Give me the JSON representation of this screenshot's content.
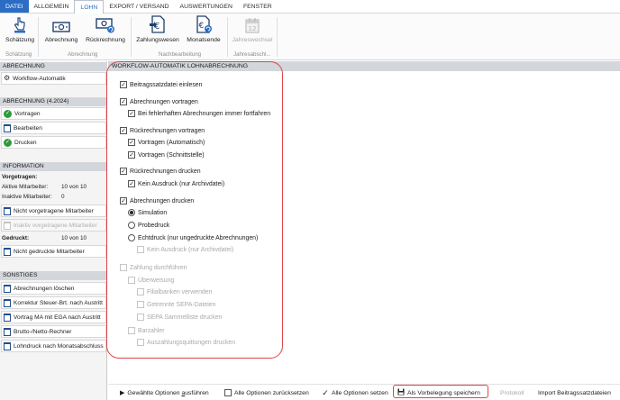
{
  "menu": {
    "tabs": [
      "DATEI",
      "ALLGEMEIN",
      "LOHN",
      "EXPORT / VERSAND",
      "AUSWERTUNGEN",
      "FENSTER"
    ],
    "active_tab": "LOHN"
  },
  "ribbon": {
    "buttons": [
      {
        "label": "Schätzung",
        "icon": "hand-pointer-icon",
        "enabled": true
      },
      {
        "label": "Abrechnung",
        "icon": "money-icon",
        "enabled": true
      },
      {
        "label": "Rückrechnung",
        "icon": "money-refresh-icon",
        "enabled": true
      },
      {
        "label": "Zahlungswesen",
        "icon": "euro-document-icon",
        "enabled": true
      },
      {
        "label": "Monatsende",
        "icon": "euro-document-refresh-icon",
        "enabled": true
      },
      {
        "label": "Jahreswechsel",
        "icon": "calendar-icon",
        "enabled": false
      }
    ],
    "calendar_day": "12",
    "groups": [
      "Schätzung",
      "Abrechnung",
      "Nachbearbeitung",
      "Jahresabschl..."
    ]
  },
  "left_panel": {
    "abrechnung_header": "ABRECHNUNG",
    "workflow_item": "Workflow-Automatik",
    "period_header": "ABRECHNUNG (4.2024)",
    "period_items": [
      "Vortragen",
      "Bearbeiten",
      "Drucken"
    ],
    "info_header": "INFORMATION",
    "vorgetragen_label": "Vorgetragen:",
    "aktive_label": "Aktive Mitarbeiter:",
    "aktive_value": "10 von 10",
    "inaktive_label": "Inaktive Mitarbeiter:",
    "inaktive_value": "0",
    "nicht_vorgetragen": "Nicht vorgetragene Mitarbeiter",
    "inaktiv_vorgetragen": "Inaktiv vorgetragene Mitarbeiter",
    "gedruckt_label": "Gedruckt:",
    "gedruckt_value": "10 von 10",
    "nicht_gedruckt": "Nicht gedruckte Mitarbeiter",
    "sonstiges_header": "SONSTIGES",
    "sonstiges_items": [
      "Abrechnungen löschen",
      "Korrektur Steuer-Brt. nach Austritt",
      "Vortrag MA mit EGA nach Austritt",
      "Brutto-/Netto-Rechner",
      "Lohndruck nach Monatsabschluss"
    ]
  },
  "main": {
    "header": "WORKFLOW-AUTOMATIK LOHNABRECHNUNG",
    "options": {
      "beitragssatzdatei": "Beitragssatzdatei einlesen",
      "abrechnungen_vortragen": "Abrechnungen vortragen",
      "bei_fehlerhaften": "Bei fehlerhaften Abrechnungen immer fortfahren",
      "rueckrechnungen_vortragen": "Rückrechnungen vortragen",
      "vortragen_automatisch": "Vortragen (Automatisch)",
      "vortragen_schnittstelle": "Vortragen (Schnittstelle)",
      "rueckrechnungen_drucken": "Rückrechnungen drucken",
      "kein_ausdruck_1": "Kein Ausdruck (nur Archivdatei)",
      "abrechnungen_drucken": "Abrechnungen drucken",
      "simulation": "Simulation",
      "probedruck": "Probedruck",
      "echtdruck": "Echtdruck (nur ungedruckte Abrechnungen)",
      "kein_ausdruck_2": "Kein Ausdruck (nur Archivdatei)",
      "zahlung_durchfuehren": "Zahlung durchführen",
      "ueberweisung": "Überweisung",
      "filialbanken": "Filialbanken verwenden",
      "getrennte_sepa": "Getrennte SEPA-Dateien",
      "sepa_sammelliste": "SEPA Sammelliste drucken",
      "barzahler": "Barzahler",
      "auszahlungsquittungen": "Auszahlungsquittungen drucken"
    }
  },
  "bottom": {
    "run_selected_pre": "Gewählte Optionen ",
    "run_selected_u": "a",
    "run_selected_post": "usführen",
    "reset_all": "Alle Optionen zurücksetzen",
    "set_all": "Alle Optionen setzen",
    "save_default": "Als Vorbelegung speichern",
    "protokoll": "Protokoll",
    "import": "Import Beitragssatzdateien"
  },
  "colors": {
    "accent": "#2b6cc4",
    "highlight": "#e0424a",
    "success": "#2e9b3b"
  }
}
